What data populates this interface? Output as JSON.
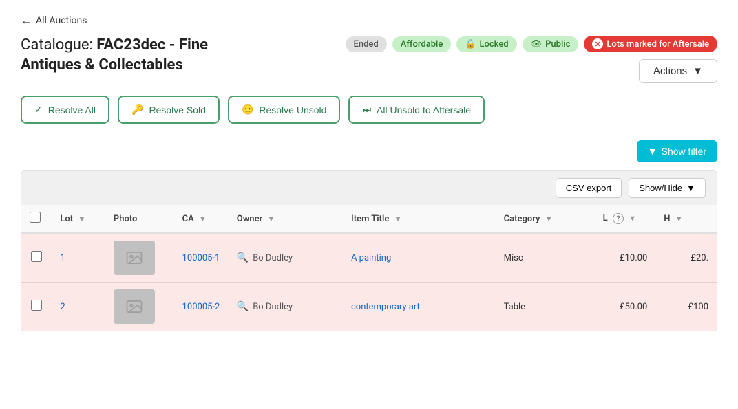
{
  "nav": {
    "back_label": "All Auctions"
  },
  "catalogue": {
    "label": "Catalogue:",
    "name_bold": "FAC23dec - Fine",
    "name_rest": "Antiques & Collectables"
  },
  "badges": [
    {
      "id": "ended",
      "label": "Ended",
      "type": "ended"
    },
    {
      "id": "affordable",
      "label": "Affordable",
      "type": "affordable"
    },
    {
      "id": "locked",
      "label": "Locked",
      "type": "locked",
      "icon": "🔒"
    },
    {
      "id": "public",
      "label": "Public",
      "type": "public",
      "icon": "👁"
    },
    {
      "id": "aftersale",
      "label": "Lots marked for Aftersale",
      "type": "aftersale"
    }
  ],
  "actions_btn": {
    "label": "Actions"
  },
  "action_buttons": [
    {
      "id": "resolve-all",
      "label": "Resolve All",
      "icon": "✓"
    },
    {
      "id": "resolve-sold",
      "label": "Resolve Sold",
      "icon": "🔑"
    },
    {
      "id": "resolve-unsold",
      "label": "Resolve Unsold",
      "icon": "😐"
    },
    {
      "id": "all-unsold-aftersale",
      "label": "All Unsold to Aftersale",
      "icon": "⏩"
    }
  ],
  "show_filter_btn": {
    "label": "Show filter",
    "icon": "▼"
  },
  "table_controls": {
    "csv_label": "CSV export",
    "show_hide_label": "Show/Hide"
  },
  "table": {
    "columns": [
      {
        "id": "checkbox",
        "label": ""
      },
      {
        "id": "lot",
        "label": "Lot"
      },
      {
        "id": "photo",
        "label": "Photo"
      },
      {
        "id": "ca",
        "label": "CA"
      },
      {
        "id": "owner",
        "label": "Owner"
      },
      {
        "id": "item_title",
        "label": "Item Title"
      },
      {
        "id": "category",
        "label": "Category"
      },
      {
        "id": "l",
        "label": "L"
      },
      {
        "id": "h",
        "label": "H"
      }
    ],
    "rows": [
      {
        "lot": "1",
        "lot_num": "1",
        "ca_link": "100005-1",
        "owner": "Bo Dudley",
        "item_title": "A painting",
        "category": "Misc",
        "l_price": "£10.00",
        "h_price": "£20."
      },
      {
        "lot": "2",
        "lot_num": "2",
        "ca_link": "100005-2",
        "owner": "Bo Dudley",
        "item_title": "contemporary art",
        "category": "Table",
        "l_price": "£50.00",
        "h_price": "£100"
      }
    ]
  }
}
